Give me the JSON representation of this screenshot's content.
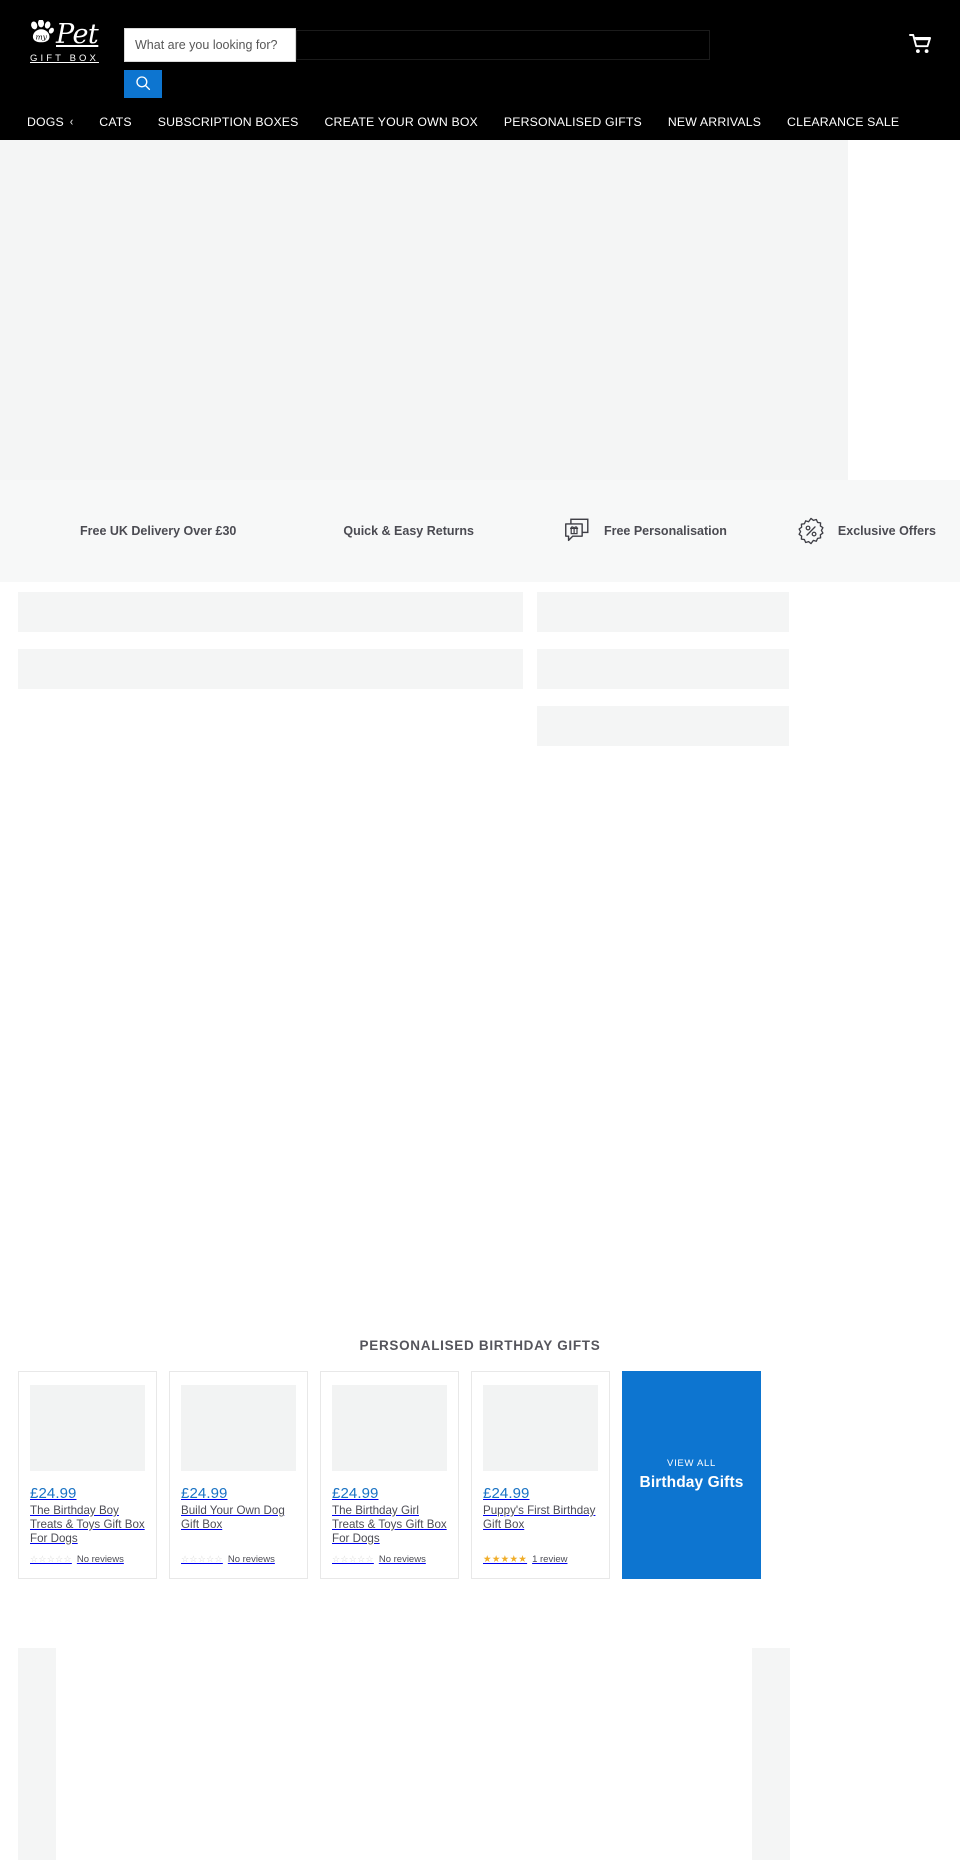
{
  "header": {
    "logo": {
      "icon": "paw-print-icon",
      "small_word": "my",
      "word": "Pet",
      "sub": "GIFT BOX"
    },
    "search": {
      "placeholder": "What are you looking for?",
      "value": "",
      "button_icon": "search-icon"
    },
    "cart_icon": "shopping-cart-icon",
    "nav": [
      {
        "label": "DOGS",
        "has_caret": true,
        "caret": "‹"
      },
      {
        "label": "CATS",
        "has_caret": false
      },
      {
        "label": "SUBSCRIPTION BOXES",
        "has_caret": false
      },
      {
        "label": "CREATE YOUR OWN BOX",
        "has_caret": false
      },
      {
        "label": "PERSONALISED GIFTS",
        "has_caret": false
      },
      {
        "label": "NEW ARRIVALS",
        "has_caret": false
      },
      {
        "label": "CLEARANCE SALE",
        "has_caret": false
      }
    ]
  },
  "trust_bar": [
    {
      "label": "Free UK Delivery Over £30",
      "icon": "delivery-truck-icon",
      "icon_visible": false
    },
    {
      "label": "Quick & Easy Returns",
      "icon": "returns-arrow-icon",
      "icon_visible": false
    },
    {
      "label": "Free Personalisation",
      "icon": "gift-chat-icon",
      "icon_visible": true
    },
    {
      "label": "Exclusive Offers",
      "icon": "percent-badge-icon",
      "icon_visible": true
    }
  ],
  "products_section": {
    "heading": "PERSONALISED BIRTHDAY GIFTS",
    "products": [
      {
        "price": "£24.99",
        "title": "The Birthday Boy Treats & Toys Gift Box For Dogs",
        "stars": "☆☆☆☆☆",
        "stars_filled": false,
        "reviews": "No reviews"
      },
      {
        "price": "£24.99",
        "title": "Build Your Own Dog Gift Box",
        "stars": "☆☆☆☆☆",
        "stars_filled": false,
        "reviews": "No reviews"
      },
      {
        "price": "£24.99",
        "title": "The Birthday Girl Treats & Toys Gift Box For Dogs",
        "stars": "☆☆☆☆☆",
        "stars_filled": false,
        "reviews": "No reviews"
      },
      {
        "price": "£24.99",
        "title": "Puppy's First Birthday Gift Box",
        "stars": "★★★★★",
        "stars_filled": true,
        "reviews": "1 review"
      }
    ],
    "view_all": {
      "kicker": "VIEW ALL",
      "title": "Birthday Gifts"
    }
  },
  "colors": {
    "brand_blue": "#0d75d0",
    "price_blue": "#1a73c4",
    "header_black": "#000000",
    "skeleton_grey": "#f4f5f5",
    "trust_bg": "#f7f8f8",
    "star_gold": "#f0ad29"
  }
}
